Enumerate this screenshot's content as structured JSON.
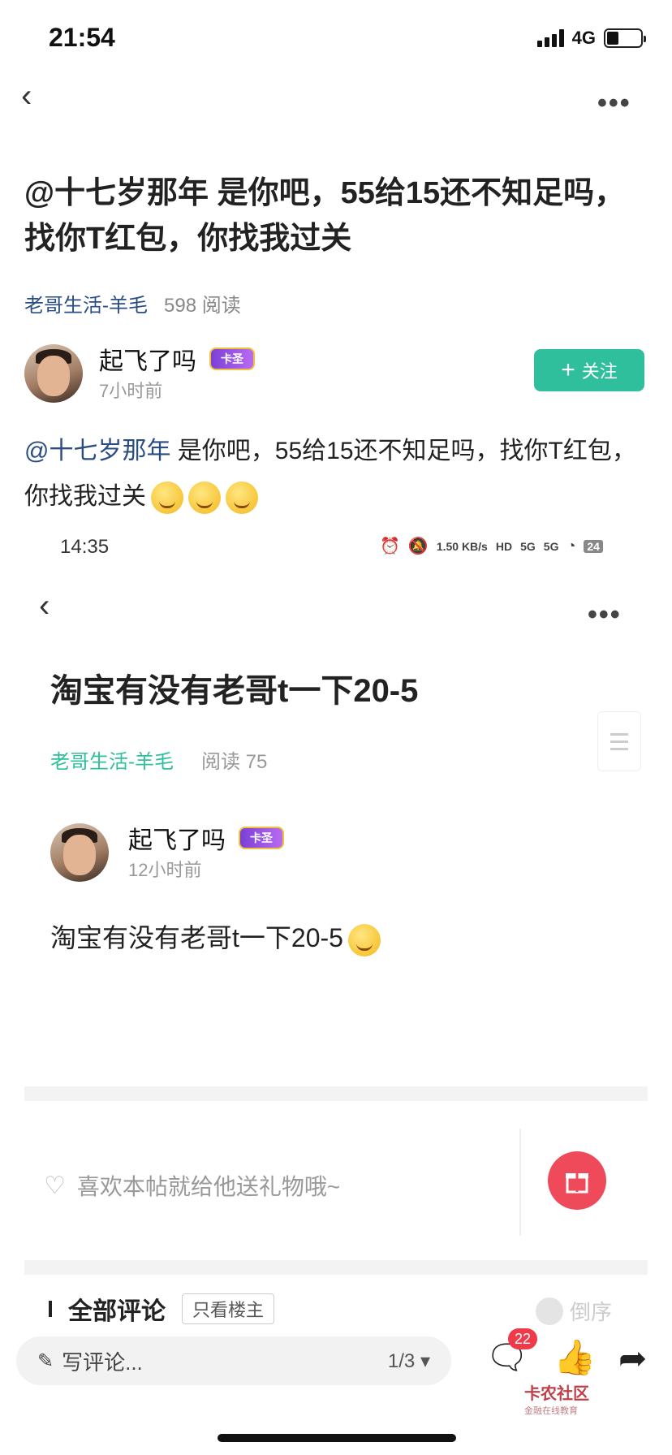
{
  "status_bar": {
    "time": "21:54",
    "network": "4G"
  },
  "post1": {
    "title": "@十七岁那年 是你吧，55给15还不知足吗，找你T红包，你找我过关",
    "category": "老哥生活-羊毛",
    "reads": "598 阅读",
    "author": {
      "name": "起飞了吗",
      "badge": "卡圣",
      "time": "7小时前"
    },
    "follow_label": "关注",
    "body_mention": "@十七岁那年",
    "body_text": " 是你吧，55给15还不知足吗，找你T红包，你找我过关"
  },
  "inner_screenshot": {
    "time": "14:35",
    "status_icons": [
      "1.50 KB/s",
      "HD",
      "5G",
      "5G",
      "24"
    ],
    "title": "淘宝有没有老哥t一下20-5",
    "category": "老哥生活-羊毛",
    "reads": "阅读 75",
    "author": {
      "name": "起飞了吗",
      "badge": "卡圣",
      "time": "12小时前"
    },
    "body": "淘宝有没有老哥t一下20-5",
    "gift_prompt": "喜欢本帖就给他送礼物哦~",
    "comments_title": "全部评论",
    "owner_only": "只看楼主",
    "order_label": "倒序"
  },
  "bottom_bar": {
    "comment_placeholder": "写评论...",
    "page_indicator": "1/3",
    "comment_count": "22",
    "watermark": "卡农社区",
    "watermark_sub": "金融在线教育"
  },
  "colors": {
    "accent": "#2fbf9c",
    "link": "#2a4d84",
    "gift": "#ef4a5a",
    "badge": "#ef3a4a"
  }
}
